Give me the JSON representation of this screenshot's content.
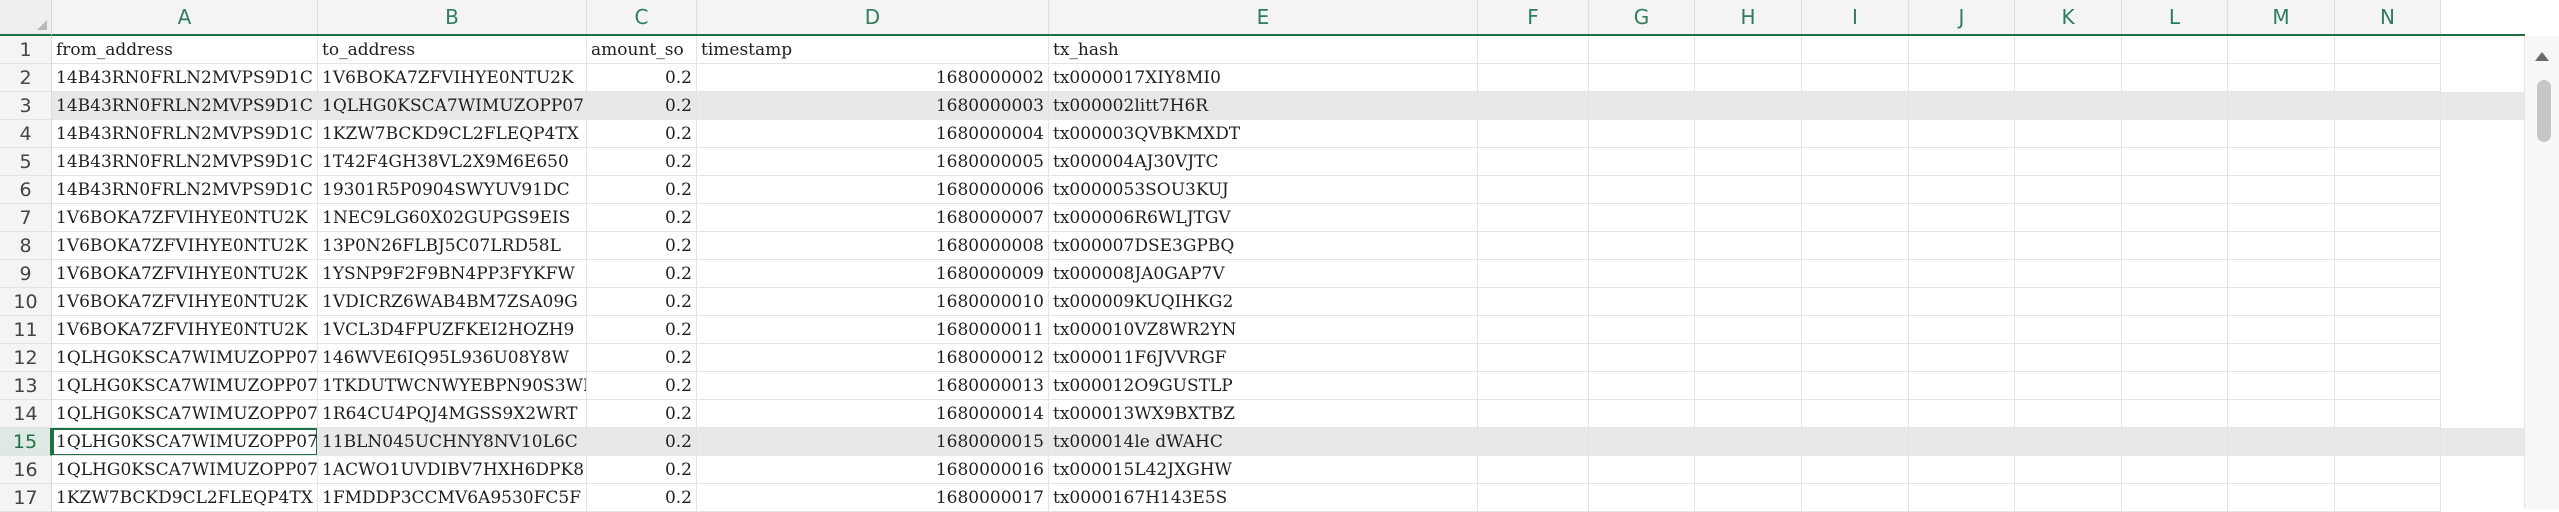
{
  "columns": [
    "A",
    "B",
    "C",
    "D",
    "E",
    "F",
    "G",
    "H",
    "I",
    "J",
    "K",
    "L",
    "M",
    "N"
  ],
  "header_row": [
    "from_address",
    "to_address",
    "amount_so",
    "timestamp",
    "tx_hash"
  ],
  "row_numbers": [
    "1",
    "2",
    "3",
    "4",
    "5",
    "6",
    "7",
    "8",
    "9",
    "10",
    "11",
    "12",
    "13",
    "14",
    "15",
    "16",
    "17"
  ],
  "selected_row_number": "15",
  "highlighted_rows": [
    "3",
    "15"
  ],
  "rows": [
    [
      "14B43RN0FRLN2MVPS9D1C",
      "1V6BOKA7ZFVIHYE0NTU2K",
      "0.2",
      "1680000002",
      "tx0000017XIY8MI0"
    ],
    [
      "14B43RN0FRLN2MVPS9D1C",
      "1QLHG0KSCA7WIMUZOPP07",
      "0.2",
      "1680000003",
      "tx000002litt7H6R"
    ],
    [
      "14B43RN0FRLN2MVPS9D1C",
      "1KZW7BCKD9CL2FLEQP4TX",
      "0.2",
      "1680000004",
      "tx000003QVBKMXDT"
    ],
    [
      "14B43RN0FRLN2MVPS9D1C",
      "1T42F4GH38VL2X9M6E650",
      "0.2",
      "1680000005",
      "tx000004AJ30VJTC"
    ],
    [
      "14B43RN0FRLN2MVPS9D1C",
      "19301R5P0904SWYUV91DC",
      "0.2",
      "1680000006",
      "tx0000053SOU3KUJ"
    ],
    [
      "1V6BOKA7ZFVIHYE0NTU2K",
      "1NEC9LG60X02GUPGS9EIS",
      "0.2",
      "1680000007",
      "tx000006R6WLJTGV"
    ],
    [
      "1V6BOKA7ZFVIHYE0NTU2K",
      "13P0N26FLBJ5C07LRD58L",
      "0.2",
      "1680000008",
      "tx000007DSE3GPBQ"
    ],
    [
      "1V6BOKA7ZFVIHYE0NTU2K",
      "1YSNP9F2F9BN4PP3FYKFW",
      "0.2",
      "1680000009",
      "tx000008JA0GAP7V"
    ],
    [
      "1V6BOKA7ZFVIHYE0NTU2K",
      "1VDICRZ6WAB4BM7ZSA09G",
      "0.2",
      "1680000010",
      "tx000009KUQIHKG2"
    ],
    [
      "1V6BOKA7ZFVIHYE0NTU2K",
      "1VCL3D4FPUZFKEI2HOZH9",
      "0.2",
      "1680000011",
      "tx000010VZ8WR2YN"
    ],
    [
      "1QLHG0KSCA7WIMUZOPP07",
      "146WVE6IQ95L936U08Y8W",
      "0.2",
      "1680000012",
      "tx000011F6JVVRGF"
    ],
    [
      "1QLHG0KSCA7WIMUZOPP07",
      "1TKDUTWCNWYEBPN90S3WI",
      "0.2",
      "1680000013",
      "tx000012O9GUSTLP"
    ],
    [
      "1QLHG0KSCA7WIMUZOPP07",
      "1R64CU4PQJ4MGSS9X2WRT",
      "0.2",
      "1680000014",
      "tx000013WX9BXTBZ"
    ],
    [
      "1QLHG0KSCA7WIMUZOPP07",
      "11BLN045UCHNY8NV10L6C",
      "0.2",
      "1680000015",
      "tx000014le dWAHC"
    ],
    [
      "1QLHG0KSCA7WIMUZOPP07",
      "1ACWO1UVDIBV7HXH6DPK8",
      "0.2",
      "1680000016",
      "tx000015L42JXGHW"
    ],
    [
      "1KZW7BCKD9CL2FLEQP4TX",
      "1FMDDP3CCMV6A9530FC5F",
      "0.2",
      "1680000017",
      "tx0000167H143E5S"
    ]
  ],
  "icons": {
    "scroll_up": "scroll-up-arrow-icon",
    "corner": "select-all-corner-icon"
  },
  "colors": {
    "accent": "#1e7145",
    "header_bg": "#f4f4f4",
    "highlight_row": "#e8e8e8"
  }
}
